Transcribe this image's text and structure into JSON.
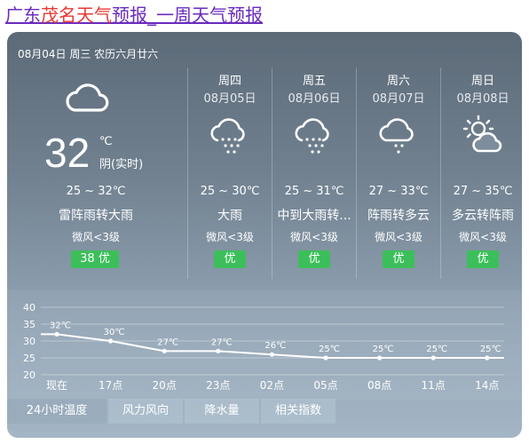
{
  "title": {
    "prefix": "广东",
    "city": "茂名天气",
    "suffix": "预报_一周天气预报"
  },
  "today": {
    "date_line": "08月04日 周三 农历六月廿六",
    "icon": "cloudy-icon",
    "temp": "32",
    "unit": "℃",
    "realtime_label": "阴(实时)",
    "range": "25 ~ 32℃",
    "desc": "雷阵雨转大雨",
    "wind": "微风<3级",
    "aqi": "38  优"
  },
  "days": [
    {
      "weekday": "周四",
      "date": "08月05日",
      "icon": "rain-icon",
      "range": "25 ~ 30℃",
      "desc": "大雨",
      "wind": "微风<3级",
      "aqi": "优"
    },
    {
      "weekday": "周五",
      "date": "08月06日",
      "icon": "rain-icon",
      "range": "25 ~ 31℃",
      "desc": "中到大雨转...",
      "wind": "微风<3级",
      "aqi": "优"
    },
    {
      "weekday": "周六",
      "date": "08月07日",
      "icon": "shower-icon",
      "range": "27 ~ 33℃",
      "desc": "阵雨转多云",
      "wind": "微风<3级",
      "aqi": "优"
    },
    {
      "weekday": "周日",
      "date": "08月08日",
      "icon": "partly-cloudy-icon",
      "range": "27 ~ 35℃",
      "desc": "多云转阵雨",
      "wind": "微风<3级",
      "aqi": "优"
    }
  ],
  "chart_data": {
    "type": "line",
    "categories": [
      "现在",
      "17点",
      "20点",
      "23点",
      "02点",
      "05点",
      "08点",
      "11点",
      "14点"
    ],
    "values": [
      32,
      30,
      27,
      27,
      26,
      25,
      25,
      25,
      25
    ],
    "value_labels": [
      "32℃",
      "30℃",
      "27℃",
      "27℃",
      "26℃",
      "25℃",
      "25℃",
      "25℃",
      "25℃"
    ],
    "y_ticks": [
      "40",
      "35",
      "30",
      "25",
      "20"
    ],
    "ylim": [
      20,
      40
    ],
    "grid": true
  },
  "tabs": [
    {
      "label": "24小时温度"
    },
    {
      "label": "风力风向"
    },
    {
      "label": "降水量"
    },
    {
      "label": "相关指数"
    }
  ],
  "colors": {
    "aqi_good": "#3cbf5a",
    "title_city": "#e53935",
    "title_link": "#6a2bbf"
  }
}
